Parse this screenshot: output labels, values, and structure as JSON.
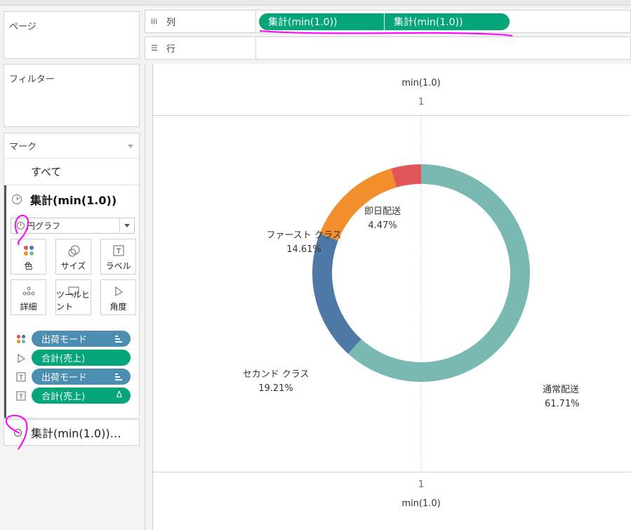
{
  "left_panel": {
    "pages_title": "ページ",
    "filters_title": "フィルター",
    "marks_title": "マーク",
    "all_label": "すべて",
    "layer_title": "集計(min(1.0))",
    "mark_type": "円グラフ",
    "mark_cards": [
      {
        "label": "色",
        "icon": "color-dots-icon"
      },
      {
        "label": "サイズ",
        "icon": "size-circles-icon"
      },
      {
        "label": "ラベル",
        "icon": "label-t-icon"
      },
      {
        "label": "詳細",
        "icon": "detail-dots-icon"
      },
      {
        "label": "ツールヒント",
        "icon": "tooltip-bubble-icon"
      },
      {
        "label": "角度",
        "icon": "angle-icon"
      }
    ],
    "encoded_pills": [
      {
        "label": "出荷モード",
        "color": "blue",
        "icon": "color-dots-icon",
        "tail": "sort"
      },
      {
        "label": "合計(売上)",
        "color": "green",
        "icon": "angle-icon",
        "tail": ""
      },
      {
        "label": "出荷モード",
        "color": "blue",
        "icon": "label-t-icon",
        "tail": "sort"
      },
      {
        "label": "合計(売上)",
        "color": "green",
        "icon": "label-t-icon",
        "tail": "Δ"
      }
    ],
    "layer2_title": "集計(min(1.0))…"
  },
  "shelves": {
    "columns_label": "列",
    "rows_label": "行",
    "column_pills": [
      "集計(min(1.0))",
      "集計(min(1.0))"
    ]
  },
  "viz": {
    "top_axis_title": "min(1.0)",
    "top_tick": "1",
    "bottom_tick": "1",
    "bottom_axis_title": "min(1.0)"
  },
  "colors": {
    "green_pill": "#05a57a",
    "blue_pill": "#4b8eb2",
    "annotation": "#ff00ff"
  },
  "chart_data": {
    "type": "pie",
    "style": "donut",
    "categories": [
      "通常配送",
      "セカンド クラス",
      "ファースト クラス",
      "即日配送"
    ],
    "values": [
      61.71,
      19.21,
      14.61,
      4.47
    ],
    "labels": [
      "61.71%",
      "19.21%",
      "14.61%",
      "4.47%"
    ],
    "colors": [
      "#7ab8b2",
      "#4e79a7",
      "#f28e2b",
      "#e15759"
    ],
    "start": "12 o'clock",
    "direction": "clockwise"
  }
}
